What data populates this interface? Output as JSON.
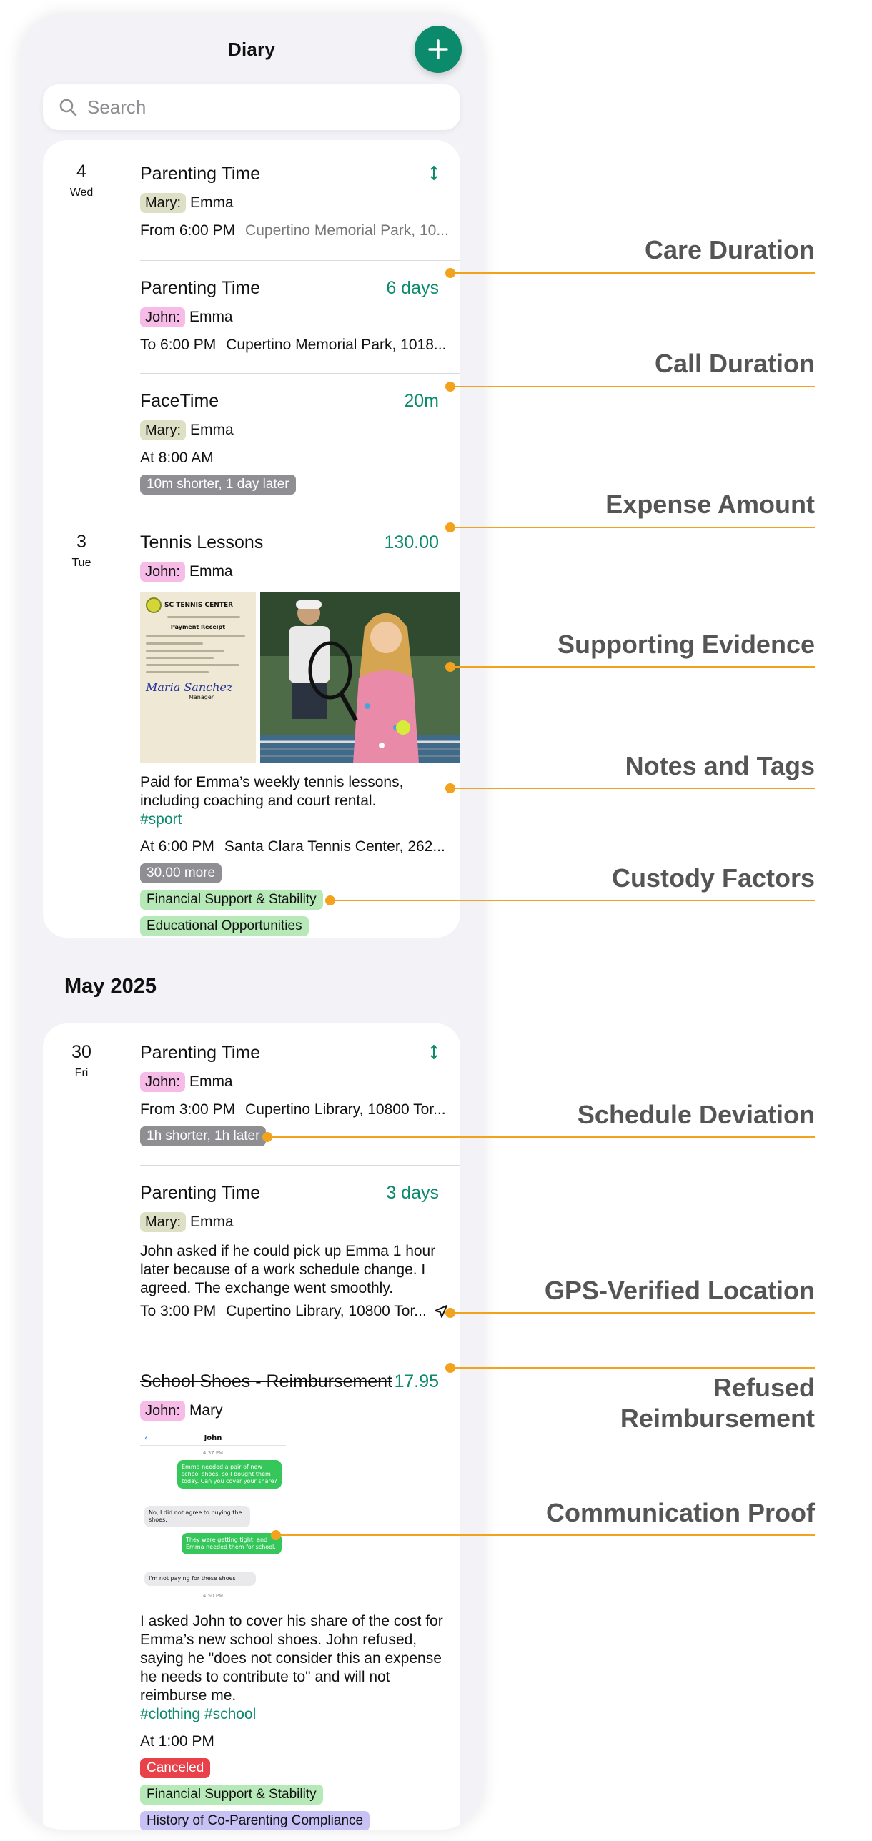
{
  "app": {
    "title": "Diary",
    "search_placeholder": "Search",
    "add_icon": "plus-icon",
    "accent_color": "#0b8a6c"
  },
  "sections": [
    {
      "days": [
        {
          "day": "4",
          "weekday": "Wed",
          "entries": [
            {
              "title": "Parenting Time",
              "value": "",
              "icon": "expand-arrows-icon",
              "parent": "Mary:",
              "child": "Emma",
              "time": "From 6:00 PM",
              "location": "Cupertino Memorial Park, 10..."
            },
            {
              "title": "Parenting Time",
              "value": "6 days",
              "parent": "John:",
              "child": "Emma",
              "time": "To 6:00 PM",
              "location": "Cupertino Memorial Park, 1018..."
            },
            {
              "title": "FaceTime",
              "value": "20m",
              "parent": "Mary:",
              "child": "Emma",
              "time": "At 8:00 AM",
              "badge": "10m shorter, 1 day later"
            }
          ]
        },
        {
          "day": "3",
          "weekday": "Tue",
          "entries": [
            {
              "title": "Tennis Lessons",
              "value": "130.00",
              "parent": "John:",
              "child": "Emma",
              "receipt": {
                "business": "SC TENNIS CENTER",
                "heading": "Payment Receipt",
                "signature": "Maria Sanchez",
                "signer_title": "Manager"
              },
              "note": "Paid for Emma’s weekly tennis lessons, including coaching and court rental.",
              "hashtags": "#sport",
              "time": "At 6:00 PM",
              "location": "Santa Clara Tennis Center, 262...",
              "badge": "30.00 more",
              "tags": [
                "Financial Support & Stability",
                "Educational Opportunities"
              ]
            }
          ]
        }
      ]
    },
    {
      "month": "May 2025",
      "days": [
        {
          "day": "30",
          "weekday": "Fri",
          "entries": [
            {
              "title": "Parenting Time",
              "value": "",
              "icon": "expand-arrows-icon",
              "parent": "John:",
              "child": "Emma",
              "time": "From 3:00 PM",
              "location": "Cupertino Library, 10800 Tor...",
              "badge": "1h shorter, 1h later"
            },
            {
              "title": "Parenting Time",
              "value": "3 days",
              "parent": "Mary:",
              "child": "Emma",
              "note": "John asked if he could pick up Emma 1 hour later because of a work schedule change. I agreed. The exchange went smoothly.",
              "time": "To 3:00 PM",
              "location": "Cupertino Library, 10800 Tor...",
              "location_icon": "gps-arrow-icon"
            },
            {
              "title": "School Shoes - Reimbursement",
              "value": "17.95",
              "parent": "John:",
              "child": "Mary",
              "chat": {
                "contact": "John",
                "time_top": "4:37 PM",
                "messages": [
                  {
                    "from": "me",
                    "text": "Emma needed a pair of new school shoes, so I bought them today. Can you cover your share?"
                  },
                  {
                    "from": "them",
                    "text": "No, I did not agree to buying the shoes."
                  },
                  {
                    "from": "me",
                    "text": "They were getting tight, and Emma needed them for school."
                  },
                  {
                    "from": "them",
                    "text": "I'm not paying for these shoes"
                  }
                ],
                "time_bottom": "4:50 PM"
              },
              "note": "I asked John to cover his share of the cost for Emma’s new school shoes. John refused, saying he \"does not consider this an expense he needs to contribute to\" and will not reimburse me.",
              "hashtags": "#clothing #school",
              "time": "At 1:00 PM",
              "badge": "Canceled",
              "tags": [
                "Financial Support & Stability",
                "History of Co-Parenting Compliance"
              ]
            }
          ]
        }
      ]
    }
  ],
  "annotations": [
    "Care Duration",
    "Call Duration",
    "Expense Amount",
    "Supporting Evidence",
    "Notes and Tags",
    "Custody Factors",
    "Schedule Deviation",
    "GPS-Verified Location",
    "Refused\nReimbursement",
    "Communication Proof"
  ],
  "colors": {
    "mary_pill": "#dde0c4",
    "john_pill": "#f6bbe6",
    "factor_tag": "#b7e8b8",
    "compliance_tag": "#c7c1f5",
    "canceled_badge": "#e9414a",
    "annotation_line": "#f3a21e"
  }
}
